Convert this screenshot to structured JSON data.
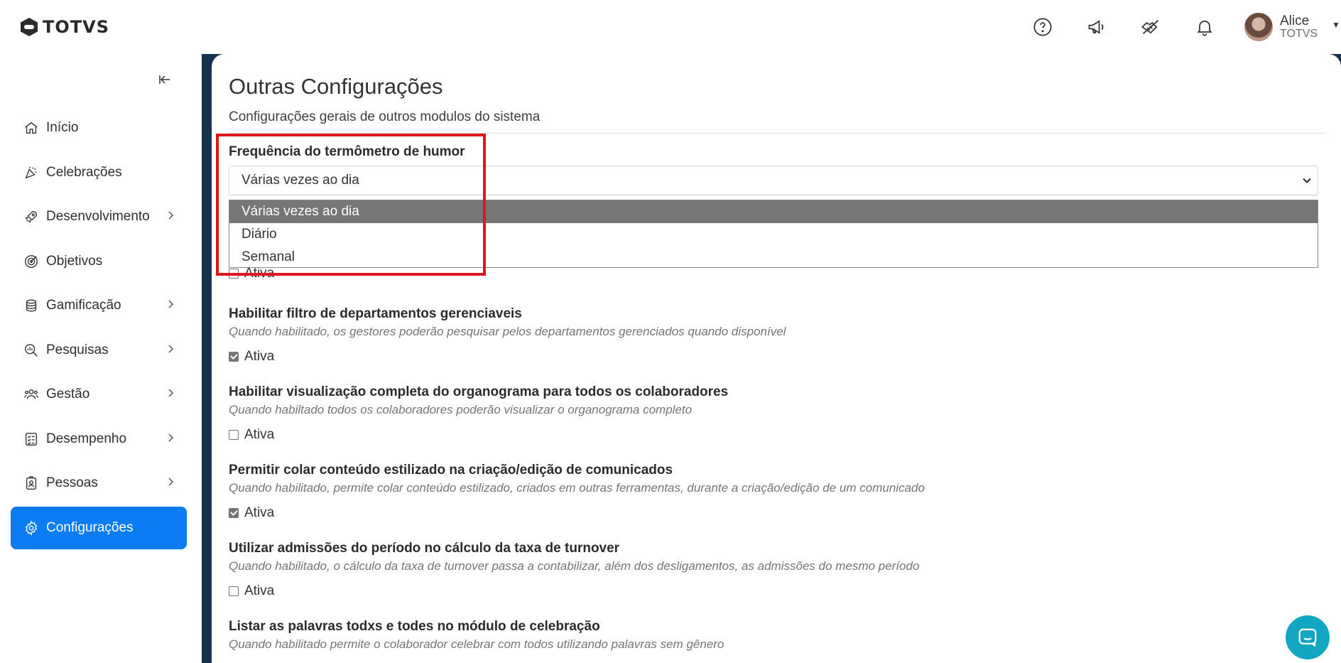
{
  "brand": {
    "name": "TOTVS"
  },
  "header": {
    "icons": [
      "help-icon",
      "megaphone-icon",
      "handshake-icon",
      "bell-icon"
    ],
    "user": {
      "name": "Alice",
      "org": "TOTVS"
    }
  },
  "sidebar": {
    "items": [
      {
        "label": "Início",
        "icon": "home-icon",
        "has_submenu": false
      },
      {
        "label": "Celebrações",
        "icon": "party-icon",
        "has_submenu": false
      },
      {
        "label": "Desenvolvimento",
        "icon": "rocket-icon",
        "has_submenu": true
      },
      {
        "label": "Objetivos",
        "icon": "target-icon",
        "has_submenu": false
      },
      {
        "label": "Gamificação",
        "icon": "coins-icon",
        "has_submenu": true
      },
      {
        "label": "Pesquisas",
        "icon": "search-chart-icon",
        "has_submenu": true
      },
      {
        "label": "Gestão",
        "icon": "people-icon",
        "has_submenu": true
      },
      {
        "label": "Desempenho",
        "icon": "checklist-icon",
        "has_submenu": true
      },
      {
        "label": "Pessoas",
        "icon": "badge-icon",
        "has_submenu": true
      },
      {
        "label": "Configurações",
        "icon": "gear-icon",
        "has_submenu": false,
        "active": true
      }
    ]
  },
  "page": {
    "title": "Outras Configurações",
    "subtitle": "Configurações gerais de outros modulos do sistema"
  },
  "mood_frequency": {
    "label": "Frequência do termômetro de humor",
    "selected": "Várias vezes ao dia",
    "options": [
      "Várias vezes ao dia",
      "Diário",
      "Semanal"
    ]
  },
  "hidden_setting": {
    "check_label": "Ativa",
    "checked": false
  },
  "settings": [
    {
      "title": "Habilitar filtro de departamentos gerenciaveis",
      "desc": "Quando habilitado, os gestores poderão pesquisar pelos departamentos gerenciados quando disponível",
      "check_label": "Ativa",
      "checked": true
    },
    {
      "title": "Habilitar visualização completa do organograma para todos os colaboradores",
      "desc": "Quando habiltado todos os colaboradores poderão visualizar o organograma completo",
      "check_label": "Ativa",
      "checked": false
    },
    {
      "title": "Permitir colar conteúdo estilizado na criação/edição de comunicados",
      "desc": "Quando habilitado, permite colar conteúdo estilizado, criados em outras ferramentas, durante a criação/edição de um comunicado",
      "check_label": "Ativa",
      "checked": true
    },
    {
      "title": "Utilizar admissões do período no cálculo da taxa de turnover",
      "desc": "Quando habilitado, o cálculo da taxa de turnover passa a contabilizar, além dos desligamentos, as admissões do mesmo período",
      "check_label": "Ativa",
      "checked": false
    },
    {
      "title": "Listar as palavras todxs e todes no módulo de celebração",
      "desc": "Quando habilitado permite o colaborador celebrar com todos utilizando palavras sem gênero"
    }
  ],
  "colors": {
    "accent": "#0c7cf2",
    "sidebar_frame": "#16324f",
    "highlight": "#e0161b",
    "selected_option": "#767676",
    "chat": "#11a7c2"
  }
}
